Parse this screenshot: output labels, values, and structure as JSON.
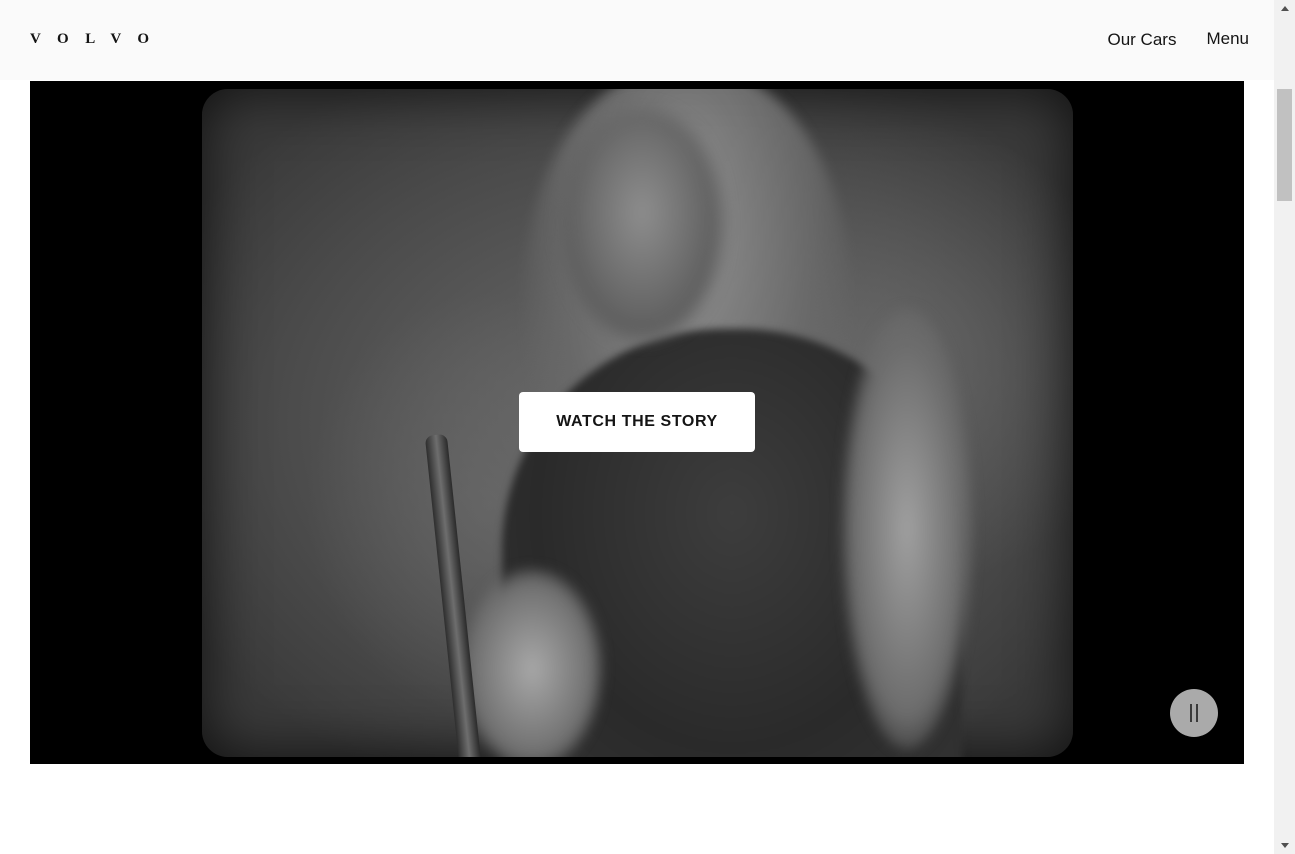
{
  "header": {
    "logo_text": "VOLVO",
    "nav": {
      "our_cars": "Our Cars",
      "menu": "Menu"
    }
  },
  "hero_video": {
    "cta_label": "WATCH THE STORY",
    "state": "playing",
    "pause_icon": "pause-icon"
  },
  "colors": {
    "header_bg": "#fafafa",
    "text": "#141414",
    "video_bg": "#000000",
    "button_bg": "#ffffff"
  }
}
